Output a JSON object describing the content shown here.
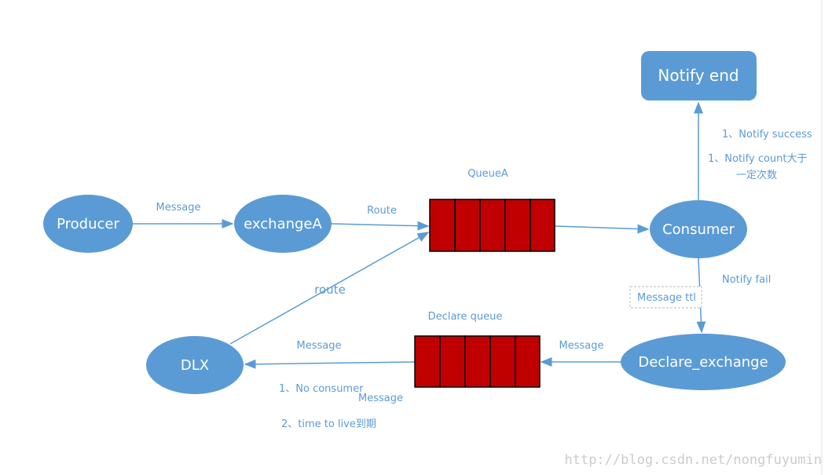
{
  "colors": {
    "node": "#5B9BD5",
    "queue": "#C00000",
    "text": "#5B9BD5"
  },
  "nodes": {
    "producer": "Producer",
    "exchangeA": "exchangeA",
    "consumer": "Consumer",
    "notify_end": "Notify end",
    "declare_exchange": "Declare_exchange",
    "dlx": "DLX"
  },
  "queues": {
    "queueA": "QueueA",
    "declare_queue": "Declare queue"
  },
  "labels": {
    "producer_to_exchange": "Message",
    "exchange_to_queue": "Route",
    "notify_success": "1、Notify success",
    "notify_count_1": "1、Notify count大于",
    "notify_count_2": "一定次数",
    "notify_fail": "Notify fail",
    "message_ttl": "Message ttl",
    "declare_to_queue": "Message",
    "queue_to_dlx": "Message",
    "dlx_route": "route",
    "no_consumer": "1、No consumer",
    "message_extra": "Message",
    "ttl_expire": "2、time to live到期"
  },
  "watermark": "http://blog.csdn.net/nongfuyumin"
}
